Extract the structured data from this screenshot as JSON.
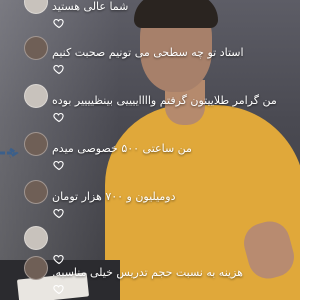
{
  "live": {
    "comments": [
      {
        "username": "",
        "text": "شما عالی هستید",
        "avatar": "light"
      },
      {
        "username": "",
        "text": "استاد تو چه سطحی می تونیم صحبت کنیم",
        "avatar": "dark"
      },
      {
        "username": "",
        "text": "من گرامر طلاییتون گرفتم وااااییییی بینظییییر بوده",
        "avatar": "light"
      },
      {
        "username": "",
        "text": "من ساعتی ۵۰۰ خصوصی میدم",
        "avatar": "dark"
      },
      {
        "username": "",
        "text": "دومیلیون و ۷۰۰ هزار تومان",
        "avatar": "dark"
      },
      {
        "username": "",
        "text": "",
        "avatar": "light"
      },
      {
        "username": "",
        "text": "هزینه به نسبت حجم تدریس خیلی مناسبه.",
        "avatar": "dark"
      }
    ]
  },
  "icons": {
    "like": "heart-outline-icon",
    "pointer": "side-pointer-icon"
  },
  "colors": {
    "shirt": "#e0a83a",
    "text": "#ffffff"
  }
}
